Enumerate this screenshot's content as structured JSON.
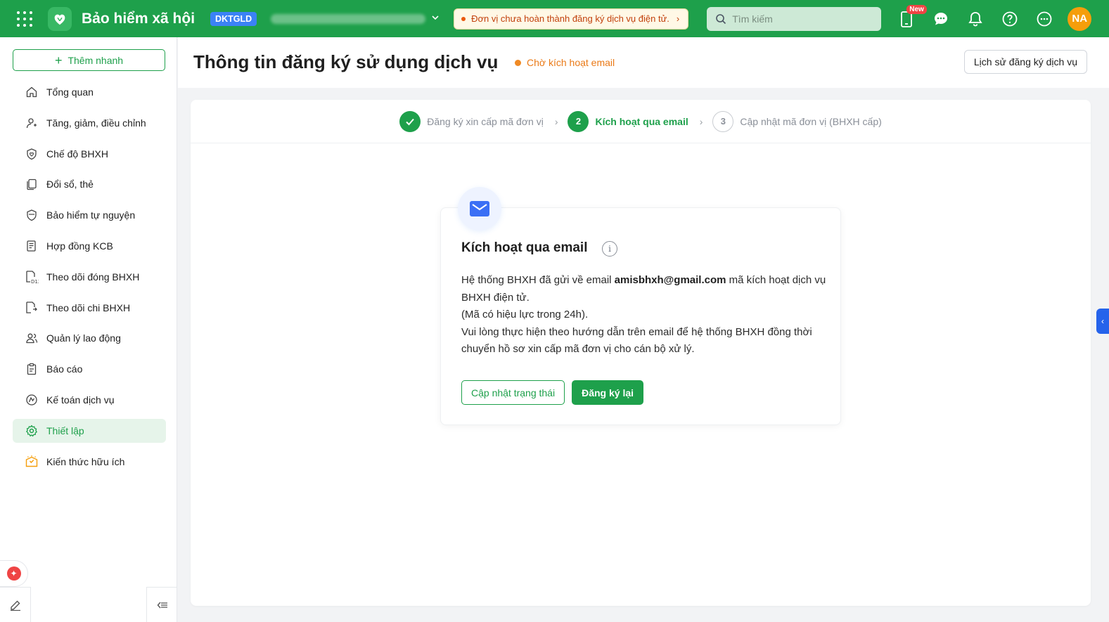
{
  "app": {
    "title": "Bảo hiểm xã hội",
    "code_badge": "DKTGLD",
    "notice": "Đơn vị chưa hoàn thành đăng ký dịch vụ điện tử.",
    "search_placeholder": "Tìm kiếm",
    "new_badge": "New",
    "avatar_initials": "NA",
    "brand_color": "#1ea04b"
  },
  "sidebar": {
    "quick_add": "Thêm nhanh",
    "items": [
      {
        "label": "Tổng quan",
        "icon": "home-icon"
      },
      {
        "label": "Tăng, giảm, điều chỉnh",
        "icon": "user-adjust-icon"
      },
      {
        "label": "Chế độ BHXH",
        "icon": "shield-heart-icon"
      },
      {
        "label": "Đổi sổ, thẻ",
        "icon": "copy-icon"
      },
      {
        "label": "Bảo hiểm tự nguyện",
        "icon": "shield-icon"
      },
      {
        "label": "Hợp đồng KCB",
        "icon": "contract-icon"
      },
      {
        "label": "Theo dõi đóng BHXH",
        "icon": "document-d12-icon"
      },
      {
        "label": "Theo dõi chi BHXH",
        "icon": "document-payout-icon"
      },
      {
        "label": "Quản lý lao động",
        "icon": "users-icon"
      },
      {
        "label": "Báo cáo",
        "icon": "clipboard-icon"
      },
      {
        "label": "Kế toán dịch vụ",
        "icon": "accounting-icon"
      },
      {
        "label": "Thiết lập",
        "icon": "gear-icon"
      },
      {
        "label": "Kiến thức hữu ích",
        "icon": "knowledge-icon"
      }
    ],
    "active_index": 11
  },
  "header": {
    "title": "Thông tin đăng ký sử dụng dịch vụ",
    "status": "Chờ kích hoạt email",
    "history_button": "Lịch sử đăng ký dịch vụ"
  },
  "stepper": {
    "steps": [
      {
        "number": "1",
        "label": "Đăng ký xin cấp mã đơn vị",
        "state": "done"
      },
      {
        "number": "2",
        "label": "Kích hoạt qua email",
        "state": "current"
      },
      {
        "number": "3",
        "label": "Cập nhật mã đơn vị (BHXH cấp)",
        "state": "todo"
      }
    ]
  },
  "email_card": {
    "title": "Kích hoạt qua email",
    "line1_prefix": "Hệ thống BHXH đã gửi về email ",
    "email": "amisbhxh@gmail.com",
    "line1_suffix": " mã kích hoạt dịch vụ BHXH điện tử.",
    "line2": "(Mã có hiệu lực trong 24h).",
    "line3": "Vui lòng thực hiện theo hướng dẫn trên email để hệ thống BHXH đồng thời chuyển hồ sơ xin cấp mã đơn vị cho cán bộ xử lý.",
    "update_button": "Cập nhật trạng thái",
    "reregister_button": "Đăng ký lại"
  }
}
